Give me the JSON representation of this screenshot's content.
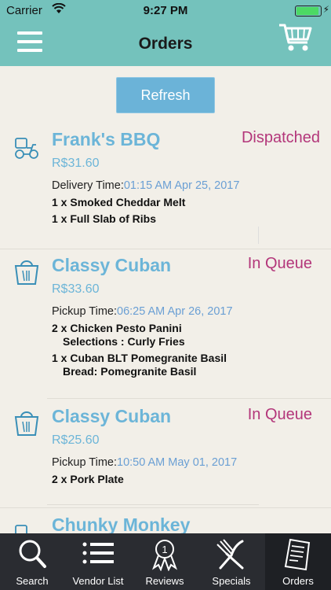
{
  "status_bar": {
    "carrier": "Carrier",
    "time": "9:27 PM"
  },
  "nav": {
    "title": "Orders"
  },
  "refresh": {
    "label": "Refresh"
  },
  "orders": [
    {
      "vendor": "Frank's BBQ",
      "status": "Dispatched",
      "price": "R$31.60",
      "time_label": "Delivery Time:",
      "time_value": "01:15 AM Apr 25, 2017",
      "items": [
        "1 x Smoked Cheddar Melt",
        "1 x Full Slab of Ribs"
      ]
    },
    {
      "vendor": "Classy Cuban",
      "status": "In Queue",
      "price": "R$33.60",
      "time_label": "Pickup Time:",
      "time_value": "06:25 AM Apr 26, 2017",
      "items": [
        "2 x Chicken Pesto Panini",
        "Selections : Curly Fries",
        "1 x Cuban BLT Pomegranite Basil",
        "Bread: Pomegranite Basil"
      ]
    },
    {
      "vendor": "Classy Cuban",
      "status": "In Queue",
      "price": "R$25.60",
      "time_label": "Pickup Time:",
      "time_value": "10:50 AM May 01, 2017",
      "items": [
        "2 x Pork Plate"
      ]
    },
    {
      "vendor": "Chunky Monkey"
    }
  ],
  "tabs": [
    {
      "label": "Search",
      "icon": "search-icon"
    },
    {
      "label": "Vendor List",
      "icon": "list-icon"
    },
    {
      "label": "Reviews",
      "icon": "award-ribbon-icon",
      "badge": "1"
    },
    {
      "label": "Specials",
      "icon": "fork-knife-icon"
    },
    {
      "label": "Orders",
      "icon": "receipt-icon"
    }
  ],
  "colors": {
    "header": "#74c2bc",
    "accent_blue": "#6cb5d8",
    "status_magenta": "#b3367a",
    "tab_bar": "#2a2c31"
  }
}
